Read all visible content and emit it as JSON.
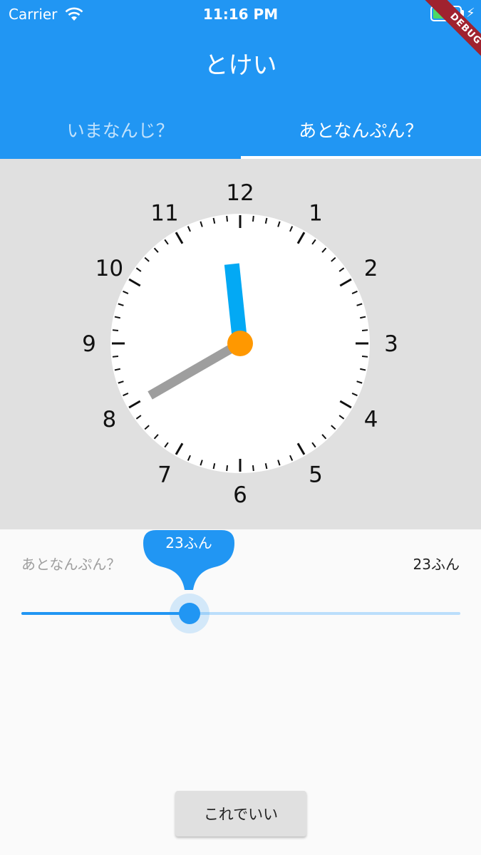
{
  "status_bar": {
    "carrier": "Carrier",
    "time": "11:16 PM",
    "battery_color": "#4cd964"
  },
  "app_bar": {
    "title": "とけい",
    "color": "#2196f3"
  },
  "tabs": [
    {
      "label": "いまなんじ？",
      "selected": false
    },
    {
      "label": "あとなんぷん？",
      "selected": true
    }
  ],
  "clock": {
    "numbers": [
      "12",
      "1",
      "2",
      "3",
      "4",
      "5",
      "6",
      "7",
      "8",
      "9",
      "10",
      "11"
    ],
    "hour_hand_color": "#03a9f4",
    "minute_hand_color": "#9e9e9e",
    "center_color": "#ff9800",
    "hour_value": 11.8,
    "minute_value": 40
  },
  "minutes_control": {
    "label": "あとなんぷん？",
    "value_text": "23ふん",
    "bubble_text": "23ふん",
    "value": 23,
    "max": 60
  },
  "confirm_button": {
    "label": "これでいい"
  },
  "debug_banner": "DEBUG"
}
